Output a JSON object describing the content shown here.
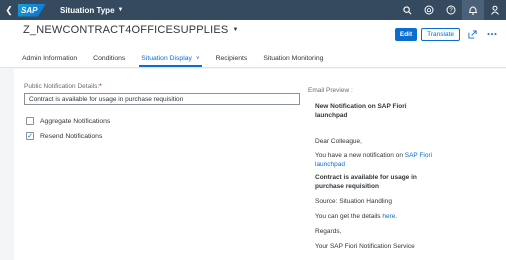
{
  "shell": {
    "logo": "SAP",
    "title": "Situation Type",
    "actions": [
      "search-icon",
      "bell-ring-icon",
      "help-icon",
      "notifications-icon",
      "user-icon"
    ]
  },
  "header": {
    "object_title": "Z_NEWCONTRACT4OFFICESUPPLIES",
    "edit_label": "Edit",
    "translate_label": "Translate"
  },
  "tabs": [
    {
      "label": "Admin Information",
      "active": false
    },
    {
      "label": "Conditions",
      "active": false
    },
    {
      "label": "Situation Display",
      "active": true
    },
    {
      "label": "Recipients",
      "active": false
    },
    {
      "label": "Situation Monitoring",
      "active": false
    }
  ],
  "form": {
    "public_details_label": "Public Notification Details:",
    "required_mark": "*",
    "public_details_value": "Contract is available for usage in purchase requisition",
    "aggregate_label": "Aggregate Notifications",
    "aggregate_checked": false,
    "resend_label": "Resend Notifications",
    "resend_checked": true
  },
  "preview": {
    "label": "Email Preview :",
    "heading": "New Notification on SAP Fiori launchpad",
    "greeting": "Dear Colleague,",
    "intro_text": "You have a new notification on ",
    "intro_link": "SAP Fiori launchpad",
    "message": "Contract is available for usage in purchase requisition",
    "source": "Source: Situation Handling",
    "details_text": "You can get the details ",
    "details_link": "here.",
    "regards": "Regards,",
    "signature": "Your SAP Fiori Notification Service"
  }
}
